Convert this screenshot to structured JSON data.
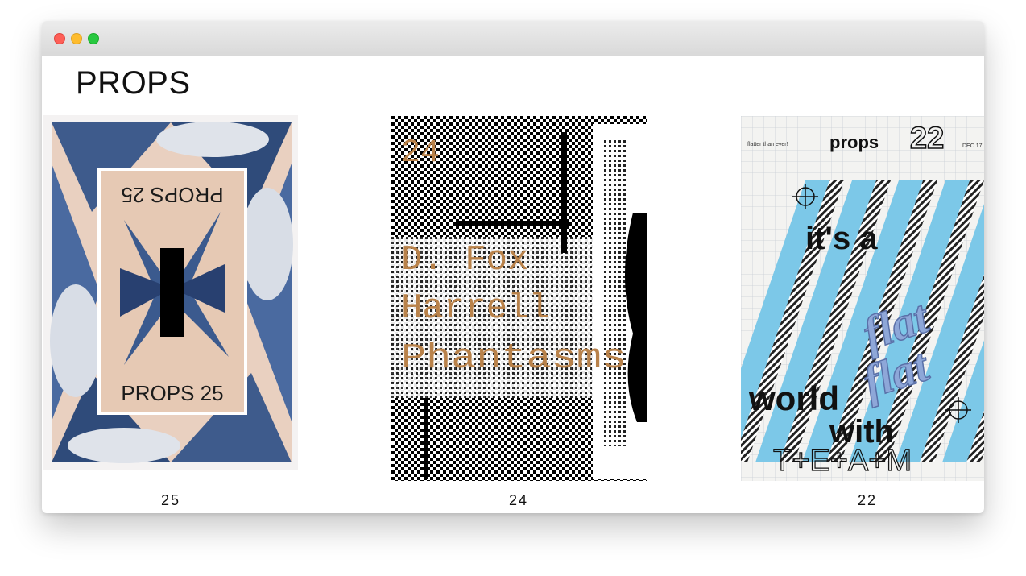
{
  "window": {
    "controls": [
      "close",
      "minimize",
      "zoom"
    ],
    "colors": {
      "close": "#fe5f57",
      "minimize": "#febc2e",
      "zoom": "#28c840"
    }
  },
  "site": {
    "title": "PROPS"
  },
  "issues": [
    {
      "caption": "25",
      "poster_text": [
        "PROPS 25",
        "PROPS 25"
      ]
    },
    {
      "caption": "24",
      "poster_text": [
        "24",
        "D. Fox",
        "Harrell",
        "Phantasms"
      ],
      "accent_color": "#b9824a"
    },
    {
      "caption": "22",
      "header_left": "flatter than ever!",
      "header_title": "props",
      "header_number": "22",
      "header_date": "DEC 17",
      "lines": [
        "it's a",
        "flat",
        "flat",
        "world",
        "with",
        "T+E+A+M"
      ],
      "accent_color": "#7cc8e8"
    }
  ]
}
